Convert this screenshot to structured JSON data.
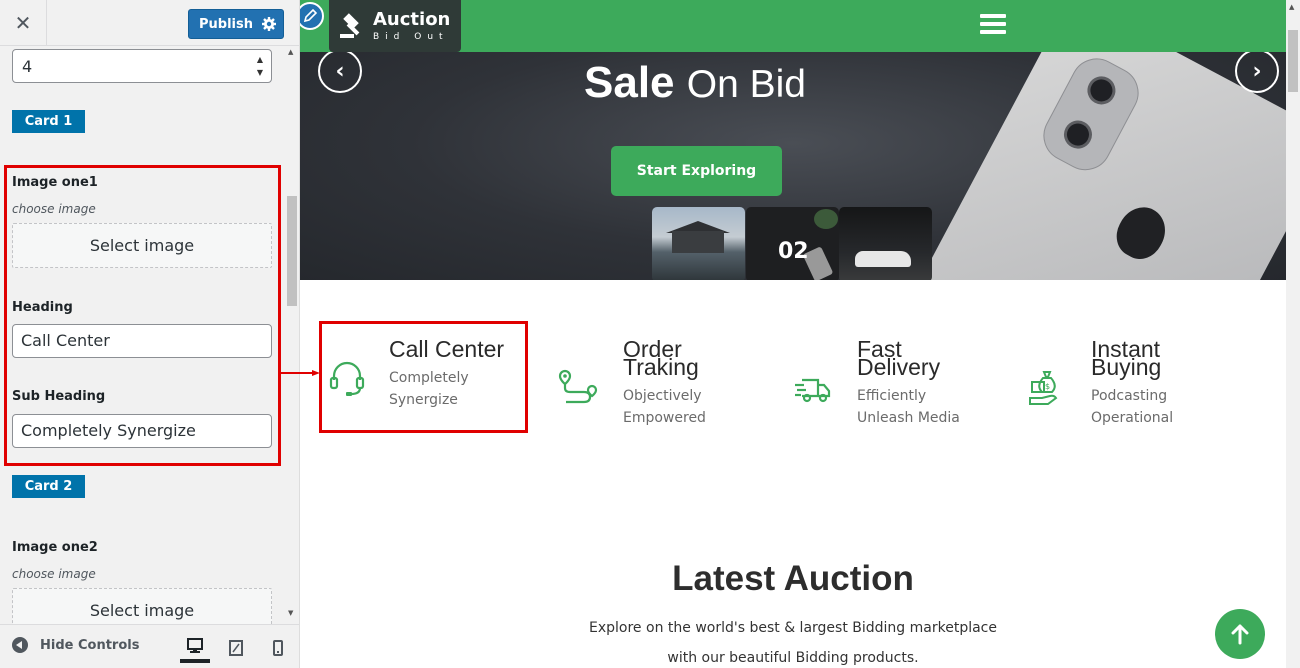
{
  "panel": {
    "close_glyph": "✕",
    "publish_label": "Publish",
    "count_value": "4",
    "card1_label": "Card 1",
    "image1_label": "Image one1",
    "image1_desc": "choose image",
    "image1_button": "Select image",
    "heading_label": "Heading",
    "heading_value": "Call Center",
    "subheading_label": "Sub Heading",
    "subheading_value": "Completely Synergize",
    "card2_label": "Card 2",
    "image2_label": "Image one2",
    "image2_desc": "choose image",
    "image2_button": "Select image",
    "hide_controls_label": "Hide Controls",
    "highlight_color": "#e00000",
    "accent_color": "#2271b1"
  },
  "site": {
    "logo_word": "Auction",
    "logo_tagline": "Bid Out",
    "brand_color": "#3daa5b",
    "hero_title_bold": "Sale",
    "hero_title_regular": "On Bid",
    "hero_button": "Start Exploring",
    "prev_arrow": "‹",
    "next_arrow": "›",
    "thumbnail_number": "02",
    "features": [
      {
        "title_line1": "Call Center",
        "title_line2": "",
        "sub_line1": "Completely",
        "sub_line2": "Synergize",
        "icon": "headset-icon"
      },
      {
        "title_line1": "Order",
        "title_line2": "Traking",
        "sub_line1": "Objectively",
        "sub_line2": "Empowered",
        "icon": "route-pin-icon"
      },
      {
        "title_line1": "Fast",
        "title_line2": "Delivery",
        "sub_line1": "Efficiently",
        "sub_line2": "Unleash Media",
        "icon": "delivery-truck-icon"
      },
      {
        "title_line1": "Instant",
        "title_line2": "Buying",
        "sub_line1": "Podcasting",
        "sub_line2": "Operational",
        "icon": "money-hand-icon"
      }
    ],
    "latest_title": "Latest Auction",
    "latest_line1": "Explore on the world's best & largest Bidding marketplace",
    "latest_line2": "with our beautiful Bidding products."
  }
}
